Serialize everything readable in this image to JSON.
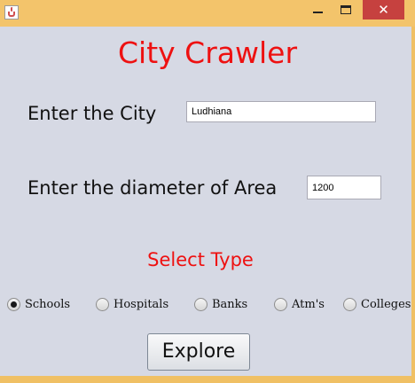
{
  "window": {
    "minimize_glyph": "",
    "close_glyph": "✕"
  },
  "app": {
    "title": "City Crawler",
    "city_label": "Enter the City",
    "city_value": "Ludhiana",
    "diameter_label": "Enter the diameter of Area",
    "diameter_value": "1200",
    "select_type_label": "Select Type",
    "types": [
      {
        "label": "Schools",
        "selected": true
      },
      {
        "label": "Hospitals",
        "selected": false
      },
      {
        "label": "Banks",
        "selected": false
      },
      {
        "label": "Atm's",
        "selected": false
      },
      {
        "label": "Colleges",
        "selected": false
      }
    ],
    "explore_label": "Explore"
  },
  "colors": {
    "titlebar": "#f3c46b",
    "close_button": "#c6413f",
    "client_bg": "#d6d9e4",
    "accent_red": "#ee1111"
  },
  "icons": {
    "app": "java-coffee-cup-icon",
    "minimize": "minimize-icon",
    "maximize": "maximize-icon",
    "close": "close-icon"
  }
}
